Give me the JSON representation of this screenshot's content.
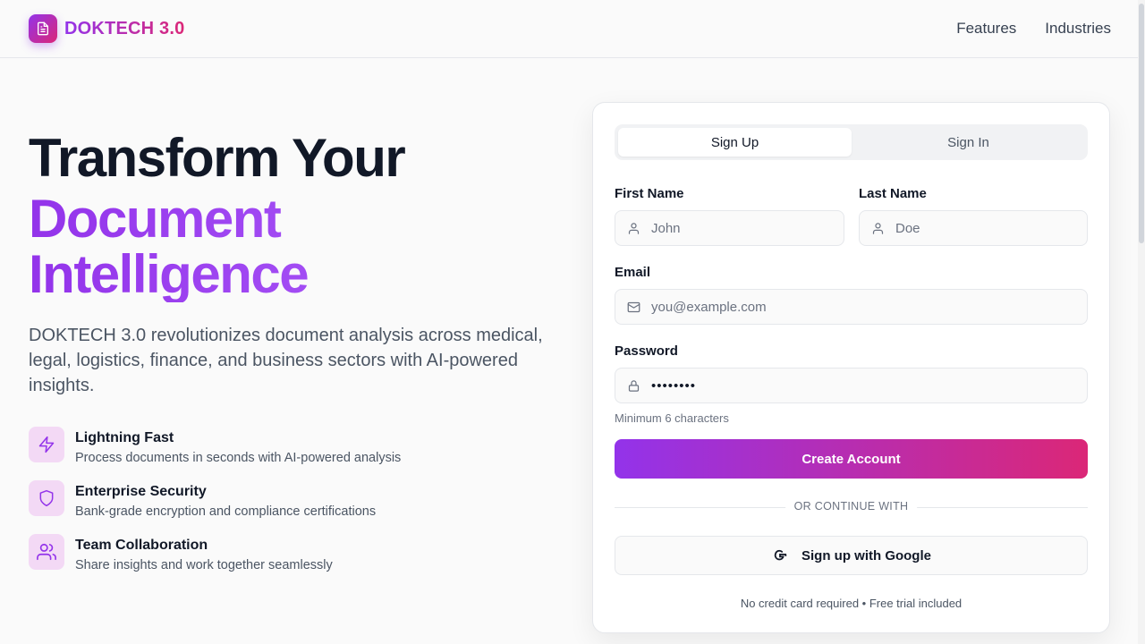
{
  "header": {
    "logo_text": "DOKTECH 3.0",
    "logo_icon": "document-icon",
    "nav": [
      "Features",
      "Industries"
    ]
  },
  "hero": {
    "title_line1": "Transform Your",
    "title_line2": "Document",
    "title_line3": "Intelligence",
    "description": "DOKTECH 3.0 revolutionizes document analysis across medical, legal, logistics, finance, and business sectors with AI-powered insights."
  },
  "features": [
    {
      "icon": "lightning-icon",
      "title": "Lightning Fast",
      "desc": "Process documents in seconds with AI-powered analysis"
    },
    {
      "icon": "shield-icon",
      "title": "Enterprise Security",
      "desc": "Bank-grade encryption and compliance certifications"
    },
    {
      "icon": "users-icon",
      "title": "Team Collaboration",
      "desc": "Share insights and work together seamlessly"
    }
  ],
  "form": {
    "tabs": [
      "Sign Up",
      "Sign In"
    ],
    "active_tab": "Sign Up",
    "first_name": {
      "label": "First Name",
      "placeholder": "John"
    },
    "last_name": {
      "label": "Last Name",
      "placeholder": "Doe"
    },
    "email": {
      "label": "Email",
      "placeholder": "you@example.com"
    },
    "password": {
      "label": "Password",
      "value": "••••••••",
      "hint": "Minimum 6 characters"
    },
    "submit": "Create Account",
    "divider": "OR CONTINUE WITH",
    "google": "Sign up with Google",
    "footnote": "No credit card required • Free trial included"
  },
  "colors": {
    "accent_start": "#9333ea",
    "accent_end": "#db2777",
    "feature_bg": "#f3d9f5"
  }
}
